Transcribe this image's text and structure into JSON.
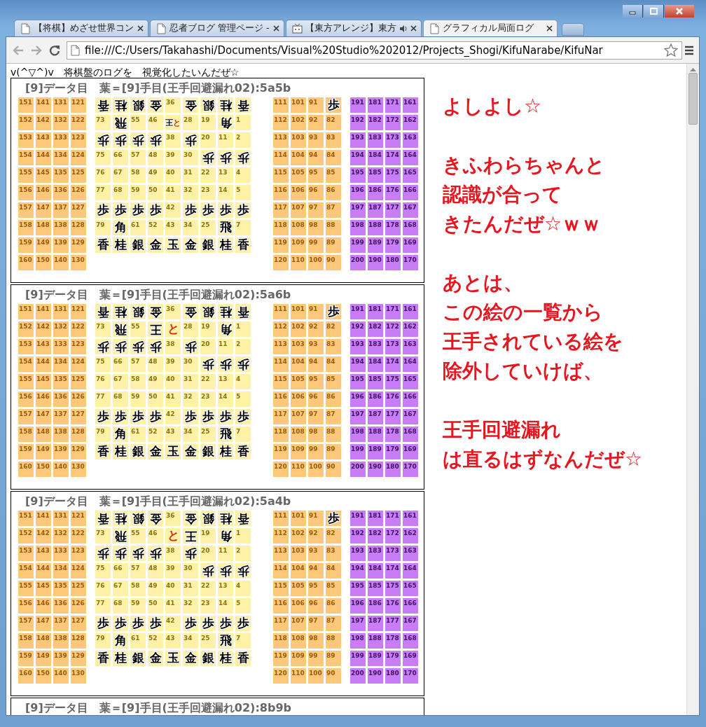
{
  "tabs": [
    {
      "title": "【将棋】めざせ世界コン",
      "selected": false,
      "audio": false
    },
    {
      "title": "忍者ブログ 管理ページ -",
      "selected": false,
      "audio": false
    },
    {
      "title": "【東方アレンジ】東方",
      "selected": false,
      "audio": true
    },
    {
      "title": "グラフィカル局面ログ",
      "selected": true,
      "audio": false
    }
  ],
  "address": "file:///C:/Users/Takahashi/Documents/Visual%20Studio%202012/Projects_Shogi/KifuNarabe/KifuNar",
  "page": {
    "heading": "v(^▽^)v　将棋盤のログを　視覚化したいんだぜ☆",
    "boards": [
      {
        "title": "[9]データ目　葉＝[9]手目(王手回避漏れ02):5a5b",
        "left_tray": [
          [
            "151",
            "141",
            "131",
            "121"
          ],
          [
            "152",
            "142",
            "132",
            "122"
          ],
          [
            "153",
            "143",
            "133",
            "123"
          ],
          [
            "154",
            "144",
            "134",
            "124"
          ],
          [
            "155",
            "145",
            "135",
            "125"
          ],
          [
            "156",
            "146",
            "136",
            "126"
          ],
          [
            "157",
            "147",
            "137",
            "127"
          ],
          [
            "158",
            "148",
            "138",
            "128"
          ],
          [
            "159",
            "149",
            "139",
            "129"
          ],
          [
            "160",
            "150",
            "140",
            "130"
          ]
        ],
        "board": [
          [
            [
              {
                "text": "香",
                "inverted": true,
                "promoted": false
              }
            ],
            [
              {
                "text": "桂",
                "inverted": true,
                "promoted": false
              }
            ],
            [
              {
                "text": "銀",
                "inverted": true,
                "promoted": false
              }
            ],
            [
              {
                "text": "金",
                "inverted": true,
                "promoted": false
              }
            ],
            "36",
            [
              {
                "text": "金",
                "inverted": true,
                "promoted": false
              }
            ],
            [
              {
                "text": "銀",
                "inverted": true,
                "promoted": false
              }
            ],
            [
              {
                "text": "桂",
                "inverted": true,
                "promoted": false
              }
            ],
            [
              {
                "text": "香",
                "inverted": true,
                "promoted": false
              }
            ]
          ],
          [
            "73",
            [
              {
                "text": "飛",
                "inverted": true,
                "promoted": false
              }
            ],
            "55",
            "46",
            [
              {
                "text": "王",
                "inverted": true,
                "promoted": false
              },
              {
                "text": "と",
                "inverted": false,
                "promoted": true
              }
            ],
            "28",
            "19",
            [
              {
                "text": "角",
                "inverted": true,
                "promoted": false
              }
            ],
            "1"
          ],
          [
            [
              {
                "text": "歩",
                "inverted": true,
                "promoted": false
              }
            ],
            [
              {
                "text": "歩",
                "inverted": true,
                "promoted": false
              }
            ],
            [
              {
                "text": "歩",
                "inverted": true,
                "promoted": false
              }
            ],
            [
              {
                "text": "歩",
                "inverted": true,
                "promoted": false
              }
            ],
            "38",
            [
              {
                "text": "歩",
                "inverted": true,
                "promoted": false
              }
            ],
            "20",
            "11",
            "2"
          ],
          [
            "75",
            "66",
            "57",
            "48",
            "39",
            "30",
            [
              {
                "text": "歩",
                "inverted": true,
                "promoted": false
              }
            ],
            [
              {
                "text": "歩",
                "inverted": true,
                "promoted": false
              }
            ],
            [
              {
                "text": "歩",
                "inverted": true,
                "promoted": false
              }
            ]
          ],
          [
            "76",
            "67",
            "58",
            "49",
            "40",
            "31",
            "22",
            "13",
            "4"
          ],
          [
            "77",
            "68",
            "59",
            "50",
            "41",
            "32",
            "23",
            "14",
            "5"
          ],
          [
            [
              {
                "text": "歩",
                "inverted": false,
                "promoted": false
              }
            ],
            [
              {
                "text": "歩",
                "inverted": false,
                "promoted": false
              }
            ],
            [
              {
                "text": "歩",
                "inverted": false,
                "promoted": false
              }
            ],
            [
              {
                "text": "歩",
                "inverted": false,
                "promoted": false
              }
            ],
            "42",
            [
              {
                "text": "歩",
                "inverted": false,
                "promoted": false
              }
            ],
            [
              {
                "text": "歩",
                "inverted": false,
                "promoted": false
              }
            ],
            [
              {
                "text": "歩",
                "inverted": false,
                "promoted": false
              }
            ],
            [
              {
                "text": "歩",
                "inverted": false,
                "promoted": false
              }
            ]
          ],
          [
            "79",
            [
              {
                "text": "角",
                "inverted": false,
                "promoted": false
              }
            ],
            "61",
            "52",
            "43",
            "34",
            "25",
            [
              {
                "text": "飛",
                "inverted": false,
                "promoted": false
              }
            ],
            "7"
          ],
          [
            [
              {
                "text": "香",
                "inverted": false,
                "promoted": false
              }
            ],
            [
              {
                "text": "桂",
                "inverted": false,
                "promoted": false
              }
            ],
            [
              {
                "text": "銀",
                "inverted": false,
                "promoted": false
              }
            ],
            [
              {
                "text": "金",
                "inverted": false,
                "promoted": false
              }
            ],
            [
              {
                "text": "玉",
                "inverted": false,
                "promoted": false
              }
            ],
            [
              {
                "text": "金",
                "inverted": false,
                "promoted": false
              }
            ],
            [
              {
                "text": "銀",
                "inverted": false,
                "promoted": false
              }
            ],
            [
              {
                "text": "桂",
                "inverted": false,
                "promoted": false
              }
            ],
            [
              {
                "text": "香",
                "inverted": false,
                "promoted": false
              }
            ]
          ]
        ],
        "middle_tray": [
          [
            "111",
            "101",
            "91",
            [
              {
                "text": "歩",
                "inverted": false,
                "promoted": false
              }
            ]
          ],
          [
            "112",
            "102",
            "92",
            "82"
          ],
          [
            "113",
            "103",
            "93",
            "83"
          ],
          [
            "114",
            "104",
            "94",
            "84"
          ],
          [
            "115",
            "105",
            "95",
            "85"
          ],
          [
            "116",
            "106",
            "96",
            "86"
          ],
          [
            "117",
            "107",
            "97",
            "87"
          ],
          [
            "118",
            "108",
            "98",
            "88"
          ],
          [
            "119",
            "109",
            "99",
            "89"
          ],
          [
            "120",
            "110",
            "100",
            "90"
          ]
        ],
        "right_tray": [
          [
            "191",
            "181",
            "171",
            "161"
          ],
          [
            "192",
            "182",
            "172",
            "162"
          ],
          [
            "193",
            "183",
            "173",
            "163"
          ],
          [
            "194",
            "184",
            "174",
            "164"
          ],
          [
            "195",
            "185",
            "175",
            "165"
          ],
          [
            "196",
            "186",
            "176",
            "166"
          ],
          [
            "197",
            "187",
            "177",
            "167"
          ],
          [
            "198",
            "188",
            "178",
            "168"
          ],
          [
            "199",
            "189",
            "179",
            "169"
          ],
          [
            "200",
            "190",
            "180",
            "170"
          ]
        ]
      },
      {
        "title": "[9]データ目　葉＝[9]手目(王手回避漏れ02):5a6b",
        "left_tray": [
          [
            "151",
            "141",
            "131",
            "121"
          ],
          [
            "152",
            "142",
            "132",
            "122"
          ],
          [
            "153",
            "143",
            "133",
            "123"
          ],
          [
            "154",
            "144",
            "134",
            "124"
          ],
          [
            "155",
            "145",
            "135",
            "125"
          ],
          [
            "156",
            "146",
            "136",
            "126"
          ],
          [
            "157",
            "147",
            "137",
            "127"
          ],
          [
            "158",
            "148",
            "138",
            "128"
          ],
          [
            "159",
            "149",
            "139",
            "129"
          ],
          [
            "160",
            "150",
            "140",
            "130"
          ]
        ],
        "board": [
          [
            [
              {
                "text": "香",
                "inverted": true,
                "promoted": false
              }
            ],
            [
              {
                "text": "桂",
                "inverted": true,
                "promoted": false
              }
            ],
            [
              {
                "text": "銀",
                "inverted": true,
                "promoted": false
              }
            ],
            [
              {
                "text": "金",
                "inverted": true,
                "promoted": false
              }
            ],
            "36",
            [
              {
                "text": "金",
                "inverted": true,
                "promoted": false
              }
            ],
            [
              {
                "text": "銀",
                "inverted": true,
                "promoted": false
              }
            ],
            [
              {
                "text": "桂",
                "inverted": true,
                "promoted": false
              }
            ],
            [
              {
                "text": "香",
                "inverted": true,
                "promoted": false
              }
            ]
          ],
          [
            "73",
            [
              {
                "text": "飛",
                "inverted": true,
                "promoted": false
              }
            ],
            "55",
            [
              {
                "text": "王",
                "inverted": true,
                "promoted": false
              }
            ],
            [
              {
                "text": "と",
                "inverted": false,
                "promoted": true
              }
            ],
            "28",
            "19",
            [
              {
                "text": "角",
                "inverted": true,
                "promoted": false
              }
            ],
            "1"
          ],
          [
            [
              {
                "text": "歩",
                "inverted": true,
                "promoted": false
              }
            ],
            [
              {
                "text": "歩",
                "inverted": true,
                "promoted": false
              }
            ],
            [
              {
                "text": "歩",
                "inverted": true,
                "promoted": false
              }
            ],
            [
              {
                "text": "歩",
                "inverted": true,
                "promoted": false
              }
            ],
            "38",
            [
              {
                "text": "歩",
                "inverted": true,
                "promoted": false
              }
            ],
            "20",
            "11",
            "2"
          ],
          [
            "75",
            "66",
            "57",
            "48",
            "39",
            "30",
            [
              {
                "text": "歩",
                "inverted": true,
                "promoted": false
              }
            ],
            [
              {
                "text": "歩",
                "inverted": true,
                "promoted": false
              }
            ],
            [
              {
                "text": "歩",
                "inverted": true,
                "promoted": false
              }
            ]
          ],
          [
            "76",
            "67",
            "58",
            "49",
            "40",
            "31",
            "22",
            "13",
            "4"
          ],
          [
            "77",
            "68",
            "59",
            "50",
            "41",
            "32",
            "23",
            "14",
            "5"
          ],
          [
            [
              {
                "text": "歩",
                "inverted": false,
                "promoted": false
              }
            ],
            [
              {
                "text": "歩",
                "inverted": false,
                "promoted": false
              }
            ],
            [
              {
                "text": "歩",
                "inverted": false,
                "promoted": false
              }
            ],
            [
              {
                "text": "歩",
                "inverted": false,
                "promoted": false
              }
            ],
            "42",
            [
              {
                "text": "歩",
                "inverted": false,
                "promoted": false
              }
            ],
            [
              {
                "text": "歩",
                "inverted": false,
                "promoted": false
              }
            ],
            [
              {
                "text": "歩",
                "inverted": false,
                "promoted": false
              }
            ],
            [
              {
                "text": "歩",
                "inverted": false,
                "promoted": false
              }
            ]
          ],
          [
            "79",
            [
              {
                "text": "角",
                "inverted": false,
                "promoted": false
              }
            ],
            "61",
            "52",
            "43",
            "34",
            "25",
            [
              {
                "text": "飛",
                "inverted": false,
                "promoted": false
              }
            ],
            "7"
          ],
          [
            [
              {
                "text": "香",
                "inverted": false,
                "promoted": false
              }
            ],
            [
              {
                "text": "桂",
                "inverted": false,
                "promoted": false
              }
            ],
            [
              {
                "text": "銀",
                "inverted": false,
                "promoted": false
              }
            ],
            [
              {
                "text": "金",
                "inverted": false,
                "promoted": false
              }
            ],
            [
              {
                "text": "玉",
                "inverted": false,
                "promoted": false
              }
            ],
            [
              {
                "text": "金",
                "inverted": false,
                "promoted": false
              }
            ],
            [
              {
                "text": "銀",
                "inverted": false,
                "promoted": false
              }
            ],
            [
              {
                "text": "桂",
                "inverted": false,
                "promoted": false
              }
            ],
            [
              {
                "text": "香",
                "inverted": false,
                "promoted": false
              }
            ]
          ]
        ],
        "middle_tray": [
          [
            "111",
            "101",
            "91",
            [
              {
                "text": "歩",
                "inverted": false,
                "promoted": false
              }
            ]
          ],
          [
            "112",
            "102",
            "92",
            "82"
          ],
          [
            "113",
            "103",
            "93",
            "83"
          ],
          [
            "114",
            "104",
            "94",
            "84"
          ],
          [
            "115",
            "105",
            "95",
            "85"
          ],
          [
            "116",
            "106",
            "96",
            "86"
          ],
          [
            "117",
            "107",
            "97",
            "87"
          ],
          [
            "118",
            "108",
            "98",
            "88"
          ],
          [
            "119",
            "109",
            "99",
            "89"
          ],
          [
            "120",
            "110",
            "100",
            "90"
          ]
        ],
        "right_tray": [
          [
            "191",
            "181",
            "171",
            "161"
          ],
          [
            "192",
            "182",
            "172",
            "162"
          ],
          [
            "193",
            "183",
            "173",
            "163"
          ],
          [
            "194",
            "184",
            "174",
            "164"
          ],
          [
            "195",
            "185",
            "175",
            "165"
          ],
          [
            "196",
            "186",
            "176",
            "166"
          ],
          [
            "197",
            "187",
            "177",
            "167"
          ],
          [
            "198",
            "188",
            "178",
            "168"
          ],
          [
            "199",
            "189",
            "179",
            "169"
          ],
          [
            "200",
            "190",
            "180",
            "170"
          ]
        ]
      },
      {
        "title": "[9]データ目　葉＝[9]手目(王手回避漏れ02):5a4b",
        "left_tray": [
          [
            "151",
            "141",
            "131",
            "121"
          ],
          [
            "152",
            "142",
            "132",
            "122"
          ],
          [
            "153",
            "143",
            "133",
            "123"
          ],
          [
            "154",
            "144",
            "134",
            "124"
          ],
          [
            "155",
            "145",
            "135",
            "125"
          ],
          [
            "156",
            "146",
            "136",
            "126"
          ],
          [
            "157",
            "147",
            "137",
            "127"
          ],
          [
            "158",
            "148",
            "138",
            "128"
          ],
          [
            "159",
            "149",
            "139",
            "129"
          ],
          [
            "160",
            "150",
            "140",
            "130"
          ]
        ],
        "board": [
          [
            [
              {
                "text": "香",
                "inverted": true,
                "promoted": false
              }
            ],
            [
              {
                "text": "桂",
                "inverted": true,
                "promoted": false
              }
            ],
            [
              {
                "text": "銀",
                "inverted": true,
                "promoted": false
              }
            ],
            [
              {
                "text": "金",
                "inverted": true,
                "promoted": false
              }
            ],
            "36",
            [
              {
                "text": "金",
                "inverted": true,
                "promoted": false
              }
            ],
            [
              {
                "text": "銀",
                "inverted": true,
                "promoted": false
              }
            ],
            [
              {
                "text": "桂",
                "inverted": true,
                "promoted": false
              }
            ],
            [
              {
                "text": "香",
                "inverted": true,
                "promoted": false
              }
            ]
          ],
          [
            "73",
            [
              {
                "text": "飛",
                "inverted": true,
                "promoted": false
              }
            ],
            "55",
            "46",
            [
              {
                "text": "と",
                "inverted": false,
                "promoted": true
              }
            ],
            [
              {
                "text": "王",
                "inverted": true,
                "promoted": false
              }
            ],
            "19",
            [
              {
                "text": "角",
                "inverted": true,
                "promoted": false
              }
            ],
            "1"
          ],
          [
            [
              {
                "text": "歩",
                "inverted": true,
                "promoted": false
              }
            ],
            [
              {
                "text": "歩",
                "inverted": true,
                "promoted": false
              }
            ],
            [
              {
                "text": "歩",
                "inverted": true,
                "promoted": false
              }
            ],
            [
              {
                "text": "歩",
                "inverted": true,
                "promoted": false
              }
            ],
            "38",
            [
              {
                "text": "歩",
                "inverted": true,
                "promoted": false
              }
            ],
            "20",
            "11",
            "2"
          ],
          [
            "75",
            "66",
            "57",
            "48",
            "39",
            "30",
            [
              {
                "text": "歩",
                "inverted": true,
                "promoted": false
              }
            ],
            [
              {
                "text": "歩",
                "inverted": true,
                "promoted": false
              }
            ],
            [
              {
                "text": "歩",
                "inverted": true,
                "promoted": false
              }
            ]
          ],
          [
            "76",
            "67",
            "58",
            "49",
            "40",
            "31",
            "22",
            "13",
            "4"
          ],
          [
            "77",
            "68",
            "59",
            "50",
            "41",
            "32",
            "23",
            "14",
            "5"
          ],
          [
            [
              {
                "text": "歩",
                "inverted": false,
                "promoted": false
              }
            ],
            [
              {
                "text": "歩",
                "inverted": false,
                "promoted": false
              }
            ],
            [
              {
                "text": "歩",
                "inverted": false,
                "promoted": false
              }
            ],
            [
              {
                "text": "歩",
                "inverted": false,
                "promoted": false
              }
            ],
            "42",
            [
              {
                "text": "歩",
                "inverted": false,
                "promoted": false
              }
            ],
            [
              {
                "text": "歩",
                "inverted": false,
                "promoted": false
              }
            ],
            [
              {
                "text": "歩",
                "inverted": false,
                "promoted": false
              }
            ],
            [
              {
                "text": "歩",
                "inverted": false,
                "promoted": false
              }
            ]
          ],
          [
            "79",
            [
              {
                "text": "角",
                "inverted": false,
                "promoted": false
              }
            ],
            "61",
            "52",
            "43",
            "34",
            "25",
            [
              {
                "text": "飛",
                "inverted": false,
                "promoted": false
              }
            ],
            "7"
          ],
          [
            [
              {
                "text": "香",
                "inverted": false,
                "promoted": false
              }
            ],
            [
              {
                "text": "桂",
                "inverted": false,
                "promoted": false
              }
            ],
            [
              {
                "text": "銀",
                "inverted": false,
                "promoted": false
              }
            ],
            [
              {
                "text": "金",
                "inverted": false,
                "promoted": false
              }
            ],
            [
              {
                "text": "玉",
                "inverted": false,
                "promoted": false
              }
            ],
            [
              {
                "text": "金",
                "inverted": false,
                "promoted": false
              }
            ],
            [
              {
                "text": "銀",
                "inverted": false,
                "promoted": false
              }
            ],
            [
              {
                "text": "桂",
                "inverted": false,
                "promoted": false
              }
            ],
            [
              {
                "text": "香",
                "inverted": false,
                "promoted": false
              }
            ]
          ]
        ],
        "middle_tray": [
          [
            "111",
            "101",
            "91",
            [
              {
                "text": "歩",
                "inverted": false,
                "promoted": false
              }
            ]
          ],
          [
            "112",
            "102",
            "92",
            "82"
          ],
          [
            "113",
            "103",
            "93",
            "83"
          ],
          [
            "114",
            "104",
            "94",
            "84"
          ],
          [
            "115",
            "105",
            "95",
            "85"
          ],
          [
            "116",
            "106",
            "96",
            "86"
          ],
          [
            "117",
            "107",
            "97",
            "87"
          ],
          [
            "118",
            "108",
            "98",
            "88"
          ],
          [
            "119",
            "109",
            "99",
            "89"
          ],
          [
            "120",
            "110",
            "100",
            "90"
          ]
        ],
        "right_tray": [
          [
            "191",
            "181",
            "171",
            "161"
          ],
          [
            "192",
            "182",
            "172",
            "162"
          ],
          [
            "193",
            "183",
            "173",
            "163"
          ],
          [
            "194",
            "184",
            "174",
            "164"
          ],
          [
            "195",
            "185",
            "175",
            "165"
          ],
          [
            "196",
            "186",
            "176",
            "166"
          ],
          [
            "197",
            "187",
            "177",
            "167"
          ],
          [
            "198",
            "188",
            "178",
            "168"
          ],
          [
            "199",
            "189",
            "179",
            "169"
          ],
          [
            "200",
            "190",
            "180",
            "170"
          ]
        ]
      },
      {
        "title": "[9]データ目　葉＝[9]手目(王手回避漏れ02):8b9b"
      }
    ],
    "notes": [
      [
        "よしよし☆"
      ],
      [
        "きふわらちゃんと",
        "認識が合って",
        "きたんだぜ☆ｗｗ"
      ],
      [
        "あとは、",
        "この絵の一覧から",
        "王手されている絵を",
        "除外していけば、"
      ],
      [
        "王手回避漏れ",
        "は直るはずなんだぜ☆"
      ]
    ]
  }
}
